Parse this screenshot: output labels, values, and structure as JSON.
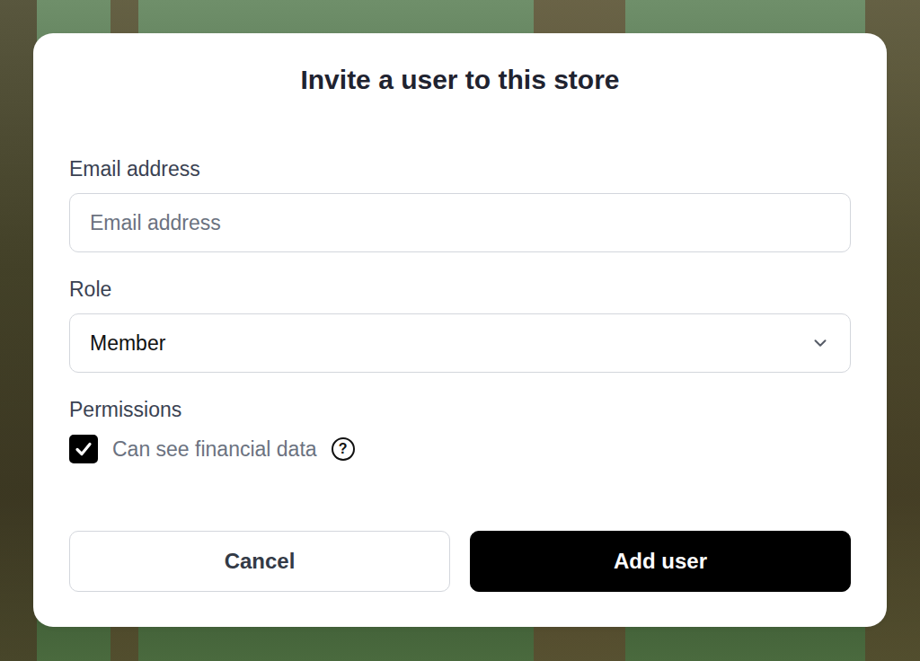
{
  "dialog": {
    "title": "Invite a user to this store",
    "fields": [
      {
        "kind": "text",
        "label": "Email address",
        "placeholder": "Email address"
      },
      {
        "kind": "select",
        "label": "Role",
        "value": "Member"
      }
    ],
    "permissions": {
      "label": "Permissions",
      "items": [
        {
          "label": "Can see financial data",
          "checked": true,
          "help_icon": "?"
        }
      ]
    },
    "buttons": [
      {
        "label": "Cancel",
        "kind": "secondary"
      },
      {
        "label": "Add user",
        "kind": "primary"
      }
    ]
  }
}
